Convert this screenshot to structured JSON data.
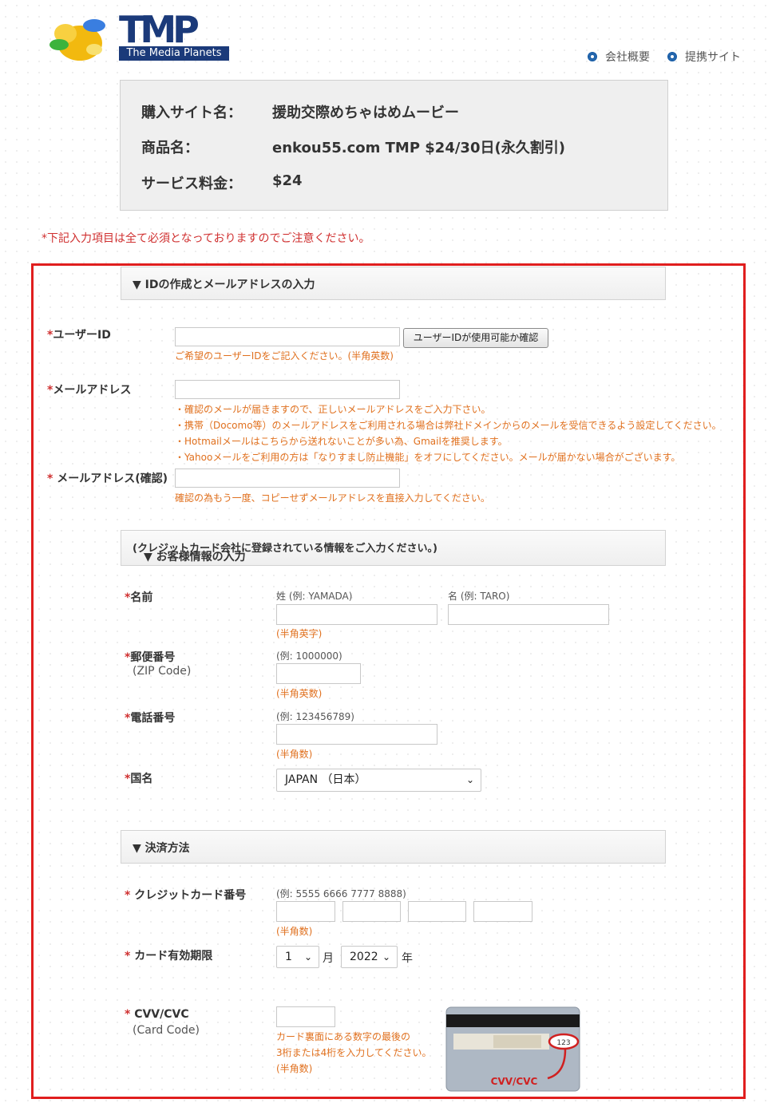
{
  "header": {
    "logo_tmp": "TMP",
    "logo_sub": "The Media Planets",
    "links": [
      "会社概要",
      "提携サイト"
    ]
  },
  "summary": {
    "site_label": "購入サイト名：",
    "site_value": "援助交際めちゃはめムービー",
    "product_label": "商品名：",
    "product_value": "enkou55.com TMP $24/30日(永久割引)",
    "fee_label": "サービス料金：",
    "fee_value": "$24"
  },
  "required_note": "*下記入力項目は全て必須となっておりますのでご注意ください。",
  "section_id": {
    "title": "▼ IDの作成とメールアドレスの入力",
    "userid_label": "ユーザーID",
    "userid_value": "",
    "check_button": "ユーザーIDが使用可能か確認",
    "userid_hint": "ご希望のユーザーIDをご記入ください。(半角英数)",
    "email_label": "メールアドレス",
    "email_value": "",
    "email_hints": [
      "・確認のメールが届きますので、正しいメールアドレスをご入力下さい。",
      "・携帯（Docomo等）のメールアドレスをご利用される場合は弊社ドメインからのメールを受信できるよう設定してください。",
      "・Hotmailメールはこちらから送れないことが多い為、Gmailを推奨します。",
      "・Yahooメールをご利用の方は「なりすまし防止機能」をオフにしてください。メールが届かない場合がございます。"
    ],
    "email_confirm_label": " メールアドレス(確認)",
    "email_confirm_value": "",
    "email_confirm_hint": "確認の為もう一度、コピーせずメールアドレスを直接入力してください。"
  },
  "section_customer": {
    "title": "▼ お客様情報の入力",
    "title_note": "(クレジットカード会社に登録されている情報をご入力ください。)",
    "name_label": "名前",
    "last_name_example": "姓 (例: YAMADA)",
    "first_name_example": "名 (例: TARO)",
    "name_hint": "(半角英字)",
    "zip_label": "郵便番号",
    "zip_sub": "(ZIP Code)",
    "zip_example": "(例: 1000000)",
    "zip_hint": "(半角英数)",
    "phone_label": "電話番号",
    "phone_example": "(例: 123456789)",
    "phone_hint": "(半角数)",
    "country_label": "国名",
    "country_value": "JAPAN （日本）"
  },
  "section_payment": {
    "title": "▼ 決済方法",
    "card_label": " クレジットカード番号",
    "card_example": "(例: 5555 6666 7777 8888)",
    "card_hint": "(半角数)",
    "expiry_label": " カード有効期限",
    "expiry_month": "1",
    "month_unit": "月",
    "expiry_year": "2022",
    "year_unit": "年",
    "cvv_label": " CVV/CVC",
    "cvv_sub": "(Card Code)",
    "cvv_hints": [
      "カード裏面にある数字の最後の",
      "3桁または4桁を入力してください。",
      "(半角数)"
    ],
    "card_image_text": "CVV/CVC",
    "card_image_code": "123"
  },
  "required_mark": "*",
  "colors": {
    "accent": "#1b3a7a",
    "required": "#d03030",
    "hint": "#e0701e",
    "frame": "#e01e1e"
  }
}
